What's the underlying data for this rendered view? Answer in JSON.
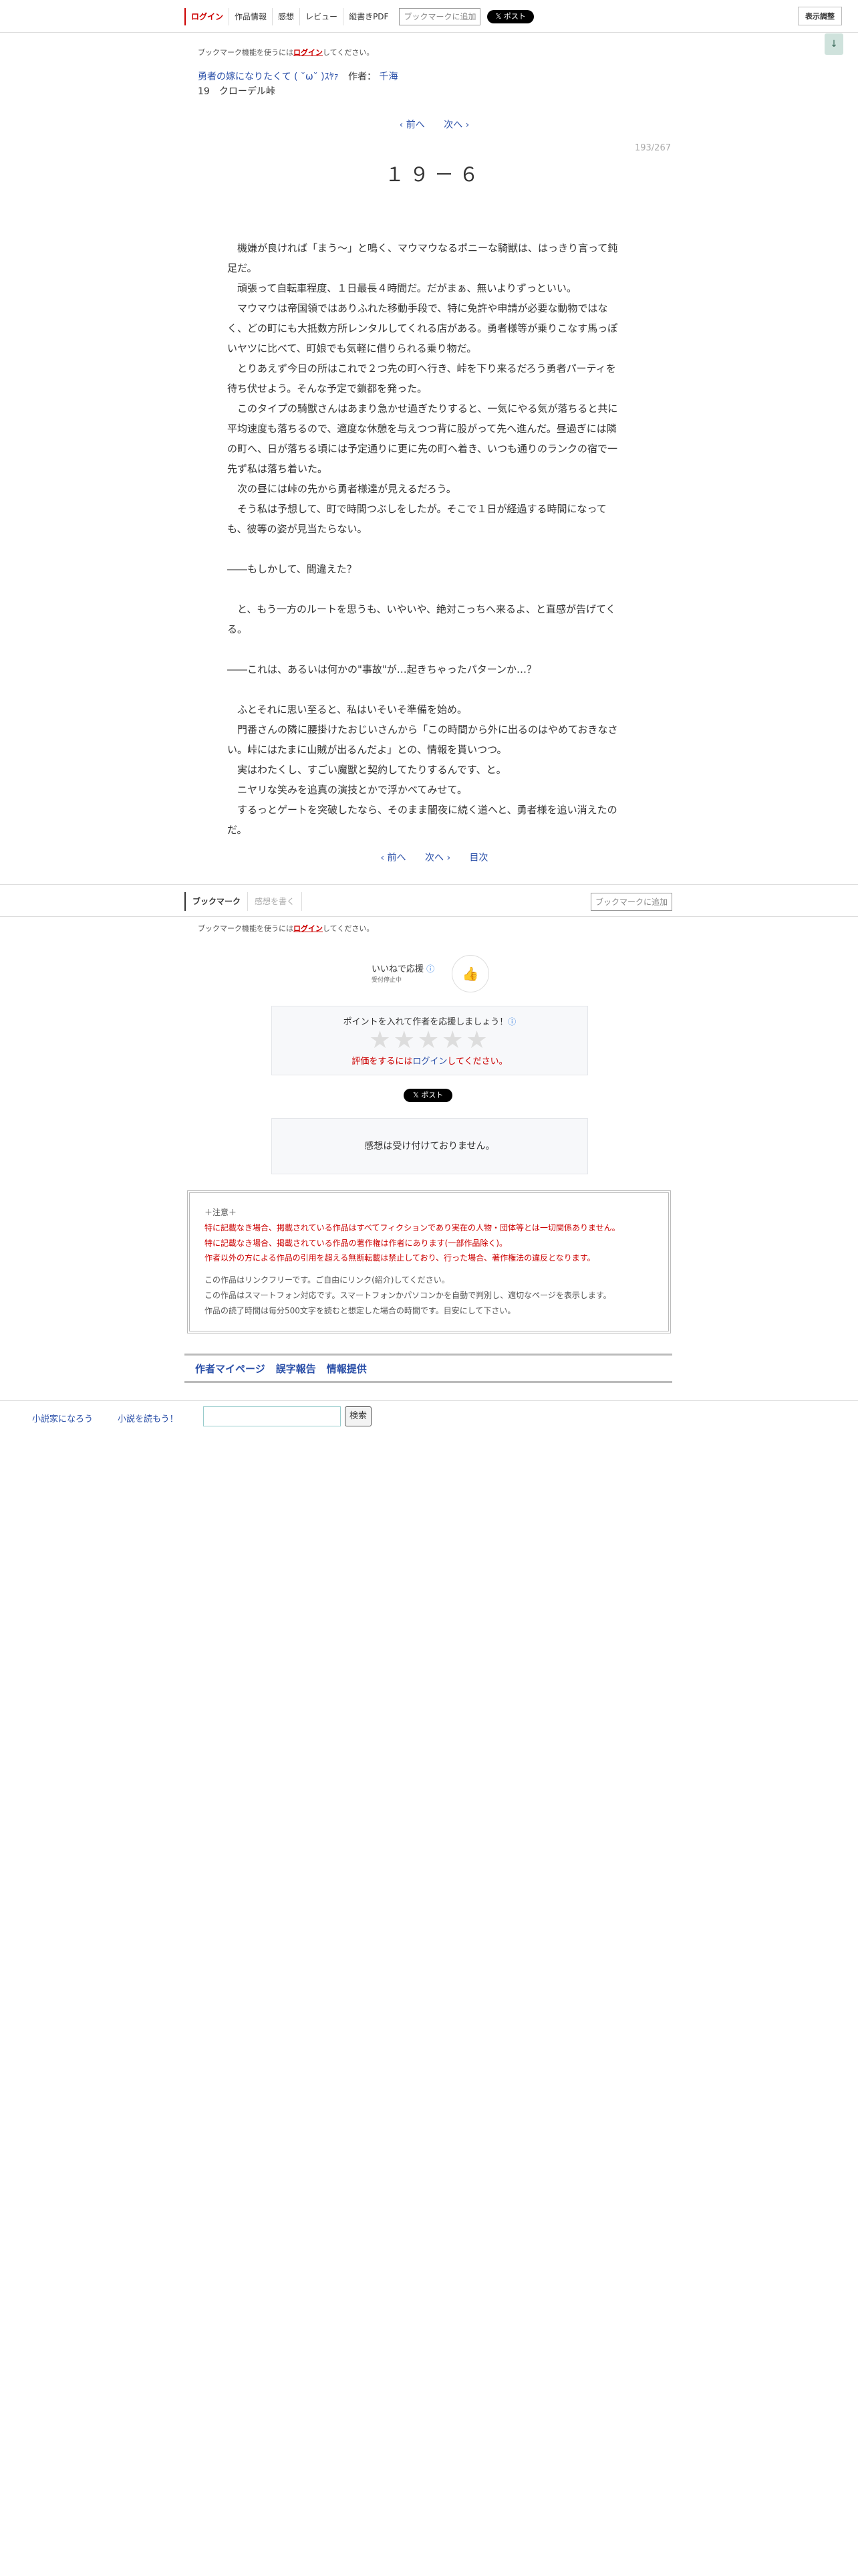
{
  "header": {
    "tabs": [
      "ログイン",
      "作品情報",
      "感想",
      "レビュー",
      "縦書きPDF"
    ],
    "bookmark_add": "ブックマークに追加",
    "x_post": "𝕏 ポスト",
    "display_adjust": "表示調整",
    "scroll_arrow": "↓"
  },
  "top_notice": {
    "prefix": "ブックマーク機能を使うには",
    "link": "ログイン",
    "suffix": "してください。"
  },
  "series": {
    "title": "勇者の嫁になりたくて ( ˘ω˘ )ｽﾔｧ",
    "author_label": "作者：",
    "author": "千海",
    "chapter_line": "19　クローデル峠"
  },
  "pager_top": {
    "prev": "‹ 前へ",
    "next": "次へ ›"
  },
  "page_num": "193/267",
  "episode_title": "１９－６",
  "body": [
    "　機嫌が良ければ「まう〜」と鳴く、マウマウなるポニーな騎獣は、はっきり言って鈍足だ。",
    "　頑張って自転車程度、１日最長４時間だ。だがまぁ、無いよりずっといい。",
    "　マウマウは帝国領ではありふれた移動手段で、特に免許や申請が必要な動物ではなく、どの町にも大抵数方所レンタルしてくれる店がある。勇者様等が乗りこなす馬っぽいヤツに比べて、町娘でも気軽に借りられる乗り物だ。",
    "　とりあえず今日の所はこれで２つ先の町へ行き、峠を下り来るだろう勇者パーティを待ち伏せよう。そんな予定で鎖都を発った。",
    "　このタイプの騎獣さんはあまり急かせ過ぎたりすると、一気にやる気が落ちると共に平均速度も落ちるので、適度な休憩を与えつつ背に股がって先へ進んだ。昼過ぎには隣の町へ、日が落ちる頃には予定通りに更に先の町へ着き、いつも通りのランクの宿で一先ず私は落ち着いた。",
    "　次の昼には峠の先から勇者様達が見えるだろう。",
    "　そう私は予想して、町で時間つぶしをしたが。そこで１日が経過する時間になっても、彼等の姿が見当たらない。",
    "",
    "――もしかして、間違えた？",
    "",
    "　と、もう一方のルートを思うも、いやいや、絶対こっちへ来るよ、と直感が告げてくる。",
    "",
    "――これは、あるいは何かの\"事故\"が…起きちゃったパターンか…？",
    "",
    "　ふとそれに思い至ると、私はいそいそ準備を始め。",
    "　門番さんの隣に腰掛けたおじいさんから「この時間から外に出るのはやめておきなさい。峠にはたまに山賊が出るんだよ」との、情報を貰いつつ。",
    "　実はわたくし、すごい魔獣と契約してたりするんです、と。",
    "　ニヤリな笑みを追真の演技とかで浮かべてみせて。",
    "　するっとゲートを突破したなら、そのまま闇夜に続く道へと、勇者様を追い消えたのだ。"
  ],
  "pager_bottom": {
    "prev": "‹ 前へ",
    "next": "次へ ›",
    "toc": "目次"
  },
  "bookmark_bar": {
    "tab1": "ブックマーク",
    "tab2": "感想を書く",
    "add": "ブックマークに追加"
  },
  "bottom_notice": {
    "prefix": "ブックマーク機能を使うには",
    "link": "ログイン",
    "suffix": "してください。"
  },
  "iine": {
    "label": "いいねで応援",
    "sub": "受付停止中",
    "help": "ⓘ"
  },
  "rating": {
    "head": "ポイントを入れて作者を応援しましょう！",
    "stars": "★★★★★",
    "prefix": "評価をするには",
    "link": "ログイン",
    "suffix": "してください。"
  },
  "x_post2": "𝕏 ポスト",
  "kansou_closed": "感想は受け付けておりません。",
  "notice": {
    "head": "＋注意＋",
    "red": [
      "特に記載なき場合、掲載されている作品はすべてフィクションであり実在の人物・団体等とは一切関係ありません。",
      "特に記載なき場合、掲載されている作品の著作権は作者にあります(一部作品除く)。",
      "作者以外の方による作品の引用を超える無断転載は禁止しており、行った場合、著作権法の違反となります。"
    ],
    "gray": [
      "この作品はリンクフリーです。ご自由にリンク(紹介)してください。",
      "この作品はスマートフォン対応です。スマートフォンかパソコンかを自動で判別し、適切なページを表示します。",
      "作品の読了時間は毎分500文字を読むと想定した場合の時間です。目安にして下さい。"
    ]
  },
  "footer_nav": [
    "作者マイページ",
    "誤字報告",
    "情報提供"
  ],
  "site_footer": {
    "link1": "小説家になろう",
    "link2": "小説を読もう！",
    "search_label": "検索"
  }
}
